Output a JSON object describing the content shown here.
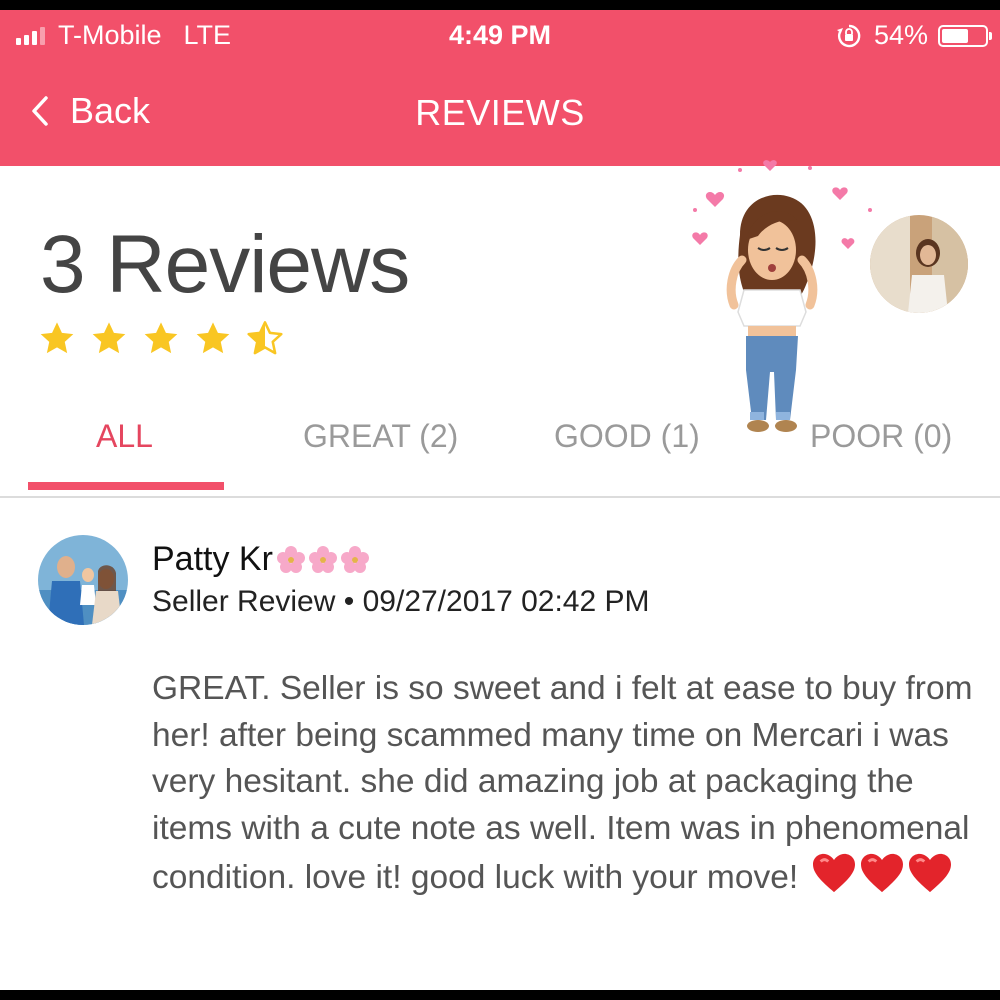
{
  "status_bar": {
    "carrier": "T-Mobile",
    "network": "LTE",
    "time": "4:49 PM",
    "battery_level": "54%"
  },
  "nav": {
    "back_label": "Back",
    "title": "REVIEWS"
  },
  "summary": {
    "review_count": "3 Reviews",
    "rating": 4.5,
    "rating_max": 5
  },
  "tabs": [
    {
      "label": "ALL",
      "active": true
    },
    {
      "label": "GREAT (2)",
      "active": false
    },
    {
      "label": "GOOD (1)",
      "active": false
    },
    {
      "label": "POOR (0)",
      "active": false
    }
  ],
  "review": {
    "name": "Patty Kr",
    "type": "Seller Review",
    "separator": "•",
    "datetime": "09/27/2017 02:42 PM",
    "text": "GREAT. Seller is so sweet and i felt at ease to buy from her! after being scammed many time on Mercari i was very hesitant. she did amazing job at packaging the items with a cute note as well. Item was in phenomenal condition. love it! good luck with your move!"
  },
  "colors": {
    "brand": "#f2506a",
    "star": "#f9c623",
    "active_tab": "#e5465f",
    "inactive_tab": "#9a9a9a"
  },
  "icons": {
    "back": "chevron-left-icon",
    "lock": "rotation-lock-icon",
    "star": "star-icon",
    "heart": "heart-icon",
    "flower": "cherry-blossom-icon"
  }
}
